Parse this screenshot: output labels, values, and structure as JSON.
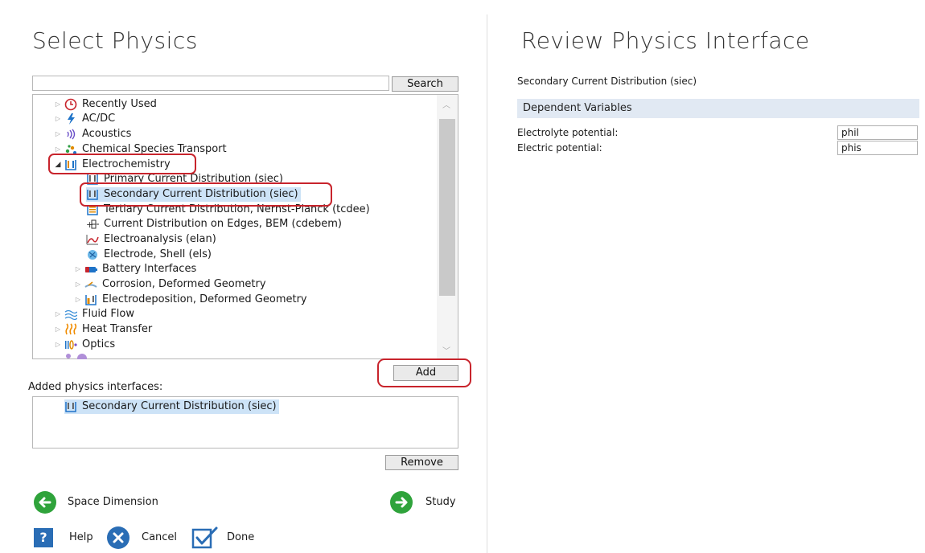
{
  "left": {
    "title": "Select Physics",
    "search": {
      "value": "",
      "button_label": "Search"
    },
    "tree": [
      {
        "label": "Recently Used",
        "icon": "clock-icon"
      },
      {
        "label": "AC/DC",
        "icon": "acdc-icon"
      },
      {
        "label": "Acoustics",
        "icon": "acoustics-icon"
      },
      {
        "label": "Chemical Species Transport",
        "icon": "chemical-species-icon"
      },
      {
        "label": "Electrochemistry",
        "icon": "electrochemistry-icon"
      },
      {
        "label": "Primary Current Distribution (siec)",
        "icon": "current-distribution-icon"
      },
      {
        "label": "Secondary Current Distribution (siec)",
        "icon": "current-distribution-icon"
      },
      {
        "label": "Tertiary Current Distribution, Nernst-Planck (tcdee)",
        "icon": "tertiary-distribution-icon"
      },
      {
        "label": "Current Distribution on Edges, BEM (cdebem)",
        "icon": "edges-bem-icon"
      },
      {
        "label": "Electroanalysis (elan)",
        "icon": "electroanalysis-icon"
      },
      {
        "label": "Electrode, Shell (els)",
        "icon": "electrode-shell-icon"
      },
      {
        "label": "Battery Interfaces",
        "icon": "battery-icon"
      },
      {
        "label": "Corrosion, Deformed Geometry",
        "icon": "corrosion-icon"
      },
      {
        "label": "Electrodeposition, Deformed Geometry",
        "icon": "electrodeposition-icon"
      },
      {
        "label": "Fluid Flow",
        "icon": "fluid-flow-icon"
      },
      {
        "label": "Heat Transfer",
        "icon": "heat-transfer-icon"
      },
      {
        "label": "Optics",
        "icon": "optics-icon"
      }
    ],
    "add_label": "Add",
    "added_header": "Added physics interfaces:",
    "added_items": [
      {
        "label": "Secondary Current Distribution (siec)",
        "icon": "current-distribution-icon"
      }
    ],
    "remove_label": "Remove",
    "back_label": "Space Dimension",
    "next_label": "Study",
    "help_label": "Help",
    "cancel_label": "Cancel",
    "done_label": "Done"
  },
  "right": {
    "title": "Review Physics Interface",
    "interface_name": "Secondary Current Distribution (siec)",
    "section_header": "Dependent Variables",
    "fields": [
      {
        "label": "Electrolyte potential:",
        "value": "phil"
      },
      {
        "label": "Electric potential:",
        "value": "phis"
      }
    ]
  },
  "colors": {
    "highlight_red": "#c8242c",
    "nav_green": "#2fa33b",
    "section_bg": "#e1e9f3",
    "selection_bg": "#cde3f7",
    "help_blue": "#2a6db5"
  }
}
